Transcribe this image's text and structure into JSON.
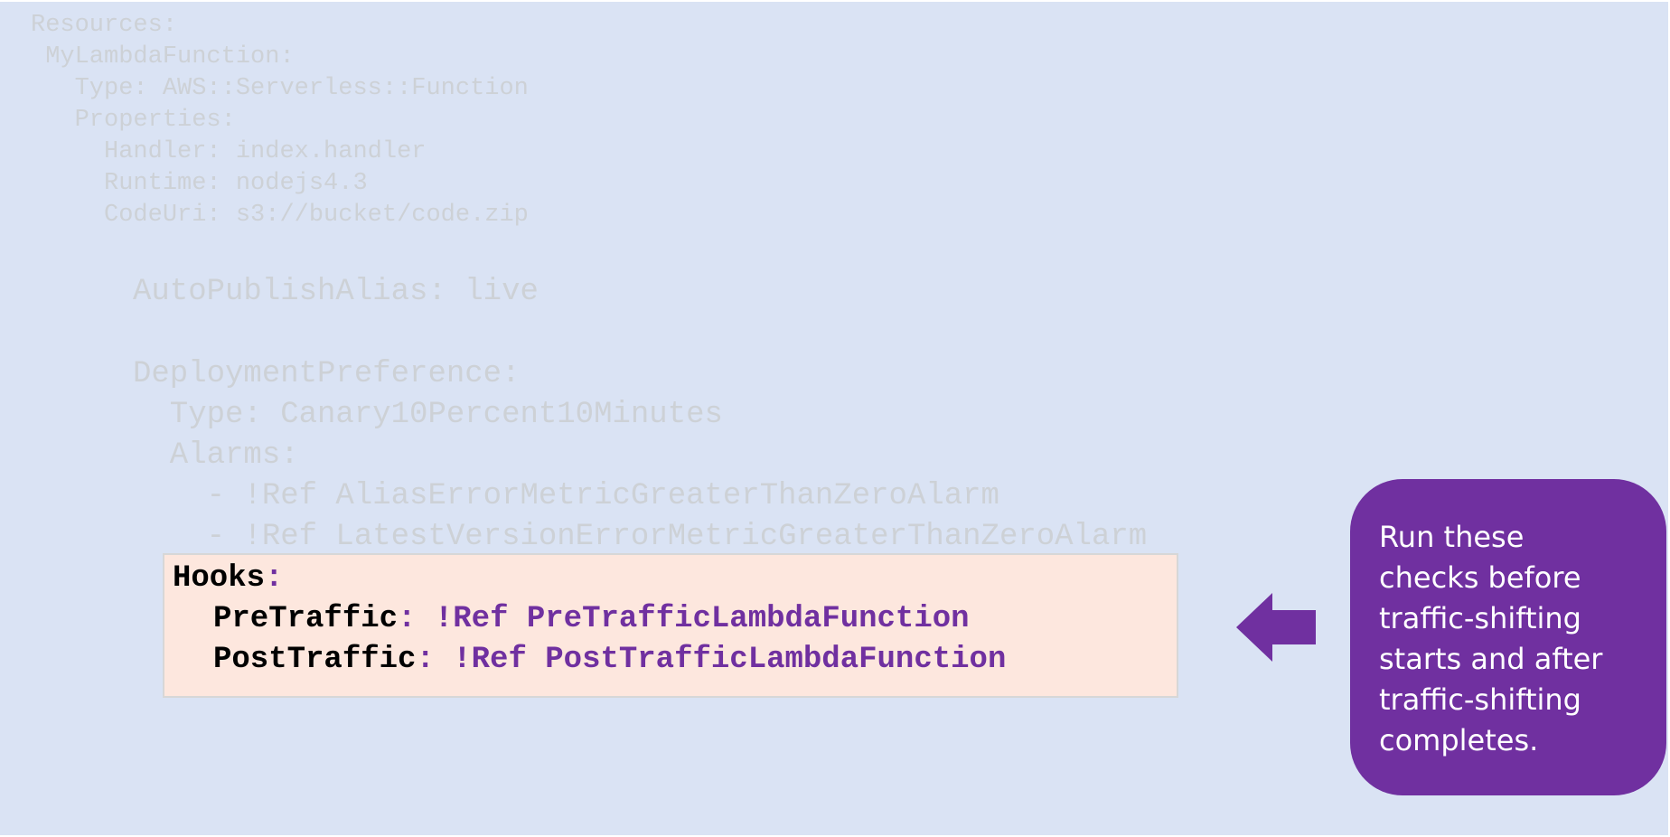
{
  "code": {
    "lines": [
      "Resources:",
      " MyLambdaFunction:",
      "   Type: AWS::Serverless::Function",
      "   Properties:",
      "     Handler: index.handler",
      "     Runtime: nodejs4.3",
      "     CodeUri: s3://bucket/code.zip",
      "AutoPublishAlias: live",
      "DeploymentPreference:",
      "  Type: Canary10Percent10Minutes",
      "  Alarms:",
      "    - !Ref AliasErrorMetricGreaterThanZeroAlarm",
      "    - !Ref LatestVersionErrorMetricGreaterThanZeroAlarm"
    ]
  },
  "hooks": {
    "key": "Hooks",
    "colon": ":",
    "pre": {
      "key": "PreTraffic",
      "value": ": !Ref PreTrafficLambdaFunction"
    },
    "post": {
      "key": "PostTraffic",
      "value": ": !Ref PostTrafficLambdaFunction"
    }
  },
  "callout": {
    "lines": [
      "Run these",
      "checks before",
      "traffic-shifting",
      "starts and after",
      "traffic-shifting",
      "completes."
    ]
  },
  "colors": {
    "background": "#dae3f4",
    "faded_code": "#cdd1d6",
    "highlight_box": "#fde7de",
    "accent_purple": "#7030a0"
  },
  "icons": {
    "arrow": "arrow-left-icon"
  }
}
